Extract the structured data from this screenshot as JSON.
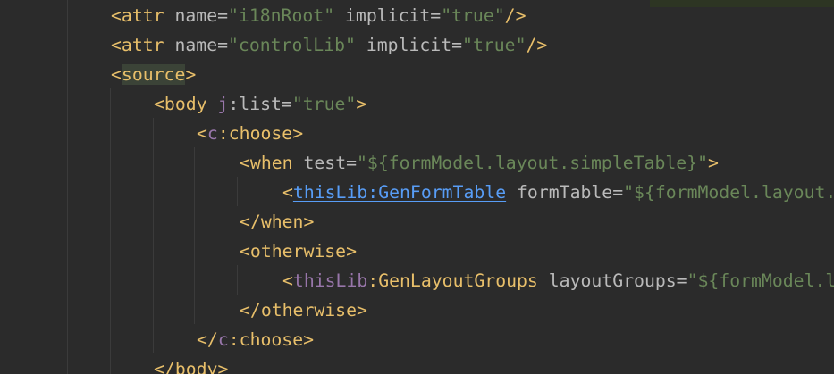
{
  "editor": {
    "lines": [
      {
        "indent": 124,
        "segments": [
          {
            "cls": "b",
            "text": "<attr "
          },
          {
            "cls": "a",
            "text": "name="
          },
          {
            "cls": "s",
            "text": "\"i18nRoot\""
          },
          {
            "cls": "a",
            "text": " implicit="
          },
          {
            "cls": "s",
            "text": "\"true\""
          },
          {
            "cls": "b",
            "text": "/>"
          }
        ]
      },
      {
        "indent": 124,
        "segments": [
          {
            "cls": "b",
            "text": "<attr "
          },
          {
            "cls": "a",
            "text": "name="
          },
          {
            "cls": "s",
            "text": "\"controlLib\""
          },
          {
            "cls": "a",
            "text": " implicit="
          },
          {
            "cls": "s",
            "text": "\"true\""
          },
          {
            "cls": "b",
            "text": "/>"
          }
        ]
      },
      {
        "indent": 124,
        "segments": [
          {
            "cls": "b",
            "text": "<"
          },
          {
            "cls": "b hl",
            "text": "source"
          },
          {
            "cls": "b",
            "text": ">"
          }
        ]
      },
      {
        "indent": 172,
        "segments": [
          {
            "cls": "b",
            "text": "<body "
          },
          {
            "cls": "p",
            "text": "j"
          },
          {
            "cls": "a",
            "text": ":list="
          },
          {
            "cls": "s",
            "text": "\"true\""
          },
          {
            "cls": "b",
            "text": ">"
          }
        ]
      },
      {
        "indent": 220,
        "segments": [
          {
            "cls": "b",
            "text": "<"
          },
          {
            "cls": "p",
            "text": "c"
          },
          {
            "cls": "b",
            "text": ":choose>"
          }
        ]
      },
      {
        "indent": 268,
        "segments": [
          {
            "cls": "b",
            "text": "<when "
          },
          {
            "cls": "a",
            "text": "test="
          },
          {
            "cls": "s",
            "text": "\"${formModel.layout.simpleTable}\""
          },
          {
            "cls": "b",
            "text": ">"
          }
        ]
      },
      {
        "indent": 316,
        "segments": [
          {
            "cls": "b",
            "text": "<"
          },
          {
            "cls": "link",
            "text": "thisLib:GenFormTable"
          },
          {
            "cls": "a",
            "text": " formTable="
          },
          {
            "cls": "s",
            "text": "\"${formModel.layout."
          }
        ]
      },
      {
        "indent": 268,
        "segments": [
          {
            "cls": "b",
            "text": "</when>"
          }
        ]
      },
      {
        "indent": 268,
        "segments": [
          {
            "cls": "b",
            "text": "<otherwise>"
          }
        ]
      },
      {
        "indent": 316,
        "segments": [
          {
            "cls": "b",
            "text": "<"
          },
          {
            "cls": "p",
            "text": "thisLib"
          },
          {
            "cls": "b",
            "text": ":GenLayoutGroups "
          },
          {
            "cls": "a",
            "text": "layoutGroups="
          },
          {
            "cls": "s",
            "text": "\"${formModel.l"
          }
        ]
      },
      {
        "indent": 268,
        "segments": [
          {
            "cls": "b",
            "text": "</otherwise>"
          }
        ]
      },
      {
        "indent": 220,
        "segments": [
          {
            "cls": "b",
            "text": "</"
          },
          {
            "cls": "p",
            "text": "c"
          },
          {
            "cls": "b",
            "text": ":choose>"
          }
        ]
      },
      {
        "indent": 172,
        "segments": [
          {
            "cls": "b",
            "text": "</body>"
          }
        ]
      }
    ]
  }
}
